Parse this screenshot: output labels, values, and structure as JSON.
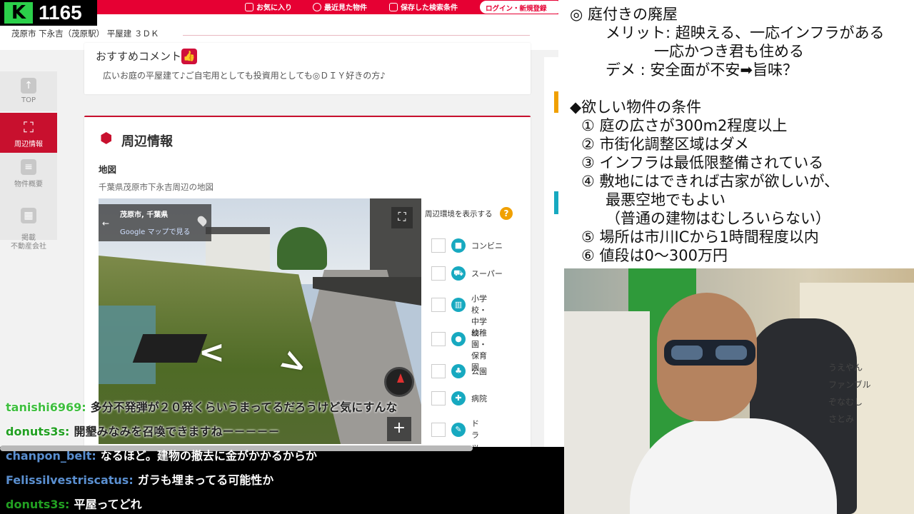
{
  "stream": {
    "viewer_count": "1165",
    "logo_letter": "K"
  },
  "site": {
    "top_links": [
      {
        "label": "お気に入り",
        "icon": "heart-icon"
      },
      {
        "label": "最近見た物件",
        "icon": "clock-icon"
      },
      {
        "label": "保存した検索条件",
        "icon": "search-save-icon"
      }
    ],
    "login_label": "ログイン・新規登録",
    "property_title": "茂原市 下永吉（茂原駅） 平屋建 ３ＤＫ",
    "side_menu": [
      {
        "label": "TOP",
        "icon": "arrow-up-icon"
      },
      {
        "label": "周辺情報",
        "icon": "map-pin-icon"
      },
      {
        "label": "物件概要",
        "icon": "document-icon"
      },
      {
        "label": "掲載\n不動産会社",
        "icon": "building-icon"
      }
    ],
    "recommend": {
      "title": "おすすめコメント",
      "text": "広いお庭の平屋建て♪ご自宅用としても投資用としても◎ＤＩＹ好きの方♪"
    },
    "area": {
      "title": "周辺情報",
      "map_label": "地図",
      "map_desc": "千葉県茂原市下永吉周辺の地図",
      "streetview": {
        "place": "茂原市, 千葉県",
        "gmaps_link": "Google マップで見る"
      },
      "facility_title": "周辺環境を表示する",
      "facilities": [
        {
          "label": "コンビニ",
          "icon": "convenience-store-icon"
        },
        {
          "label": "スーパー",
          "icon": "cart-icon"
        },
        {
          "label": "小学校・\n中学校",
          "icon": "school-icon"
        },
        {
          "label": "幼稚園・\n保育園",
          "icon": "kindergarten-icon"
        },
        {
          "label": "公園",
          "icon": "park-icon"
        },
        {
          "label": "病院",
          "icon": "hospital-icon"
        },
        {
          "label": "ドラッグ\nストア",
          "icon": "drugstore-icon"
        }
      ]
    }
  },
  "chat": [
    {
      "user": "tanishi6969:",
      "msg": "多分不発弾が２０発くらいうまってるだろうけど気にすんな",
      "user_color": "#3fbf3f",
      "style": "light"
    },
    {
      "user": "donuts3s:",
      "msg": "開墾みなみを召喚できますねー－－－－",
      "user_color": "#22a022",
      "style": "light"
    },
    {
      "user": "chanpon_belt:",
      "msg": "なるほど。建物の撤去に金がかかるからか",
      "user_color": "#5a8fd0",
      "style": "dark"
    },
    {
      "user": "Felissilvestriscatus:",
      "msg": "ガラも埋まってる可能性か",
      "user_color": "#5a8fd0",
      "style": "dark"
    },
    {
      "user": "donuts3s:",
      "msg": "平屋ってどれ",
      "user_color": "#22a022",
      "style": "dark"
    }
  ],
  "notes": [
    "◎ 庭付きの廃屋",
    "メリット: 超映える、一応インフラがある",
    "一応かつき君も住める",
    "デメ : 安全面が不安➡旨味？",
    "◆欲しい物件の条件",
    "① 庭の広さが300m2程度以上",
    "② 市街化調整区域はダメ",
    "③ インフラは最低限整備されている",
    "④ 敷地にはできれば古家が欲しいが、",
    "最悪空地でもよい",
    "（普通の建物はむしろいらない）",
    "⑤ 場所は市川ICから1時間程度以内",
    "⑥ 値段は0〜300万円"
  ],
  "webcam": {
    "board_names": [
      "うえやん",
      "ファンブル",
      "ぞなむし",
      "さとみ"
    ]
  },
  "colors": {
    "brand_red": "#e60033",
    "accent_orange": "#f0a000",
    "facility_teal": "#17a9c0"
  }
}
